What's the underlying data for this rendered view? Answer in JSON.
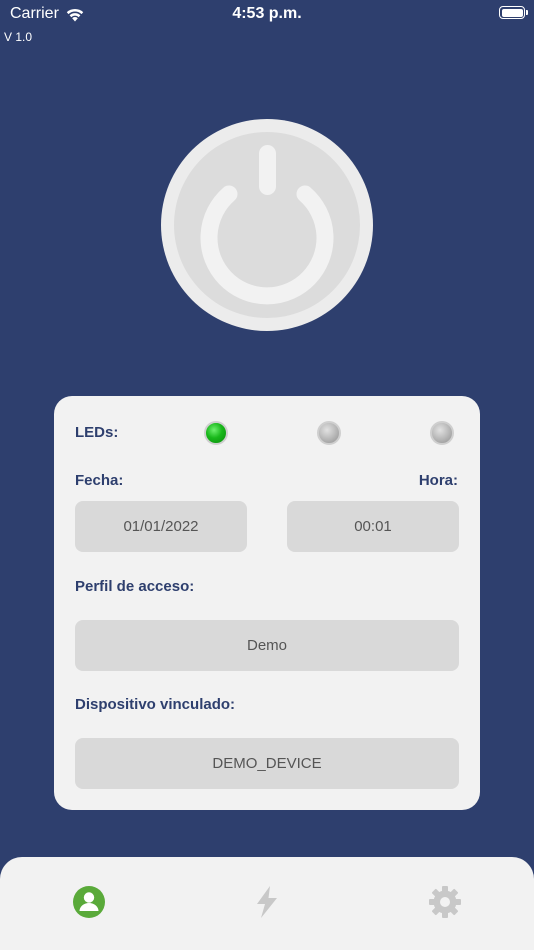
{
  "status_bar": {
    "carrier": "Carrier",
    "time": "4:53 p.m."
  },
  "app": {
    "version": "V 1.0"
  },
  "colors": {
    "background": "#2e3f6e",
    "card": "#f2f2f2",
    "field": "#d9d9d9",
    "label": "#2e3f6e",
    "led_on": "#19b81b",
    "tab_active": "#5aaa3a",
    "tab_inactive": "#c8c8c8"
  },
  "power": {
    "icon": "power-icon"
  },
  "card": {
    "leds_label": "LEDs:",
    "leds": [
      {
        "state": "on",
        "color": "green"
      },
      {
        "state": "off",
        "color": "gray"
      },
      {
        "state": "off",
        "color": "gray"
      }
    ],
    "date_label": "Fecha:",
    "time_label": "Hora:",
    "date_value": "01/01/2022",
    "time_value": "00:01",
    "profile_label": "Perfil de acceso:",
    "profile_value": "Demo",
    "device_label": "Dispositivo vinculado:",
    "device_value": "DEMO_DEVICE"
  },
  "tab_bar": {
    "tabs": [
      {
        "icon": "user-icon",
        "active": true
      },
      {
        "icon": "lightning-icon",
        "active": false
      },
      {
        "icon": "gear-icon",
        "active": false
      }
    ]
  }
}
